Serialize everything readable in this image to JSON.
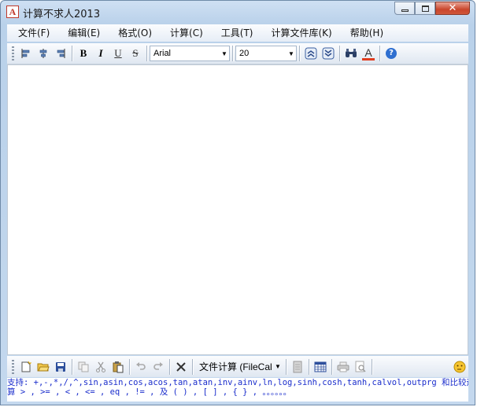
{
  "window": {
    "title": "计算不求人2013",
    "icon_letter": "A"
  },
  "title_buttons": {
    "minimize": "▭",
    "maximize": "□",
    "close": "✕"
  },
  "menu": [
    "文件(F)",
    "编辑(E)",
    "格式(O)",
    "计算(C)",
    "工具(T)",
    "计算文件库(K)",
    "帮助(H)"
  ],
  "toolbar": {
    "bold": "B",
    "italic": "I",
    "underline": "U",
    "strike": "S",
    "font_name": "Arial",
    "font_size": "20",
    "font_color": "A",
    "help": "?"
  },
  "bottom_toolbar": {
    "calc_mode": "文件计算 (FileCal"
  },
  "status": {
    "line1": "支持: +,-,*,/,^,sin,asin,cos,acos,tan,atan,inv,ainv,ln,log,sinh,cosh,tanh,calvol,outprg 和比较运",
    "line2": "算 > , >= , < , <= , eq , != , 及 ( ) , [ ] , { } , 。。。。。。"
  },
  "colors": {
    "accent": "#1a2dcc",
    "font_color_bar": "#e03c1e"
  }
}
